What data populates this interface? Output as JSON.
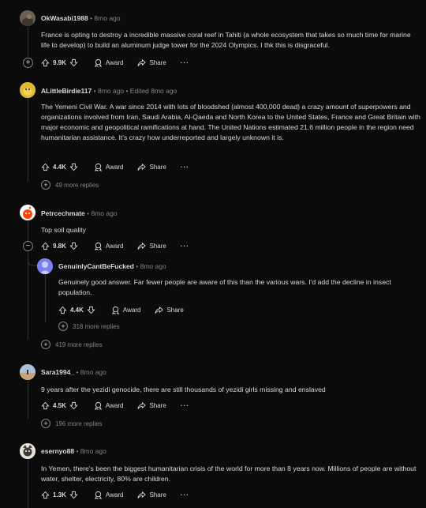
{
  "comments": [
    {
      "author": "OkWasabi1988",
      "time": "8mo ago",
      "body": "France is opting to destroy a incredible massive coral reef in Tahiti (a whole ecosystem that takes so much time for marine life to develop) to build an aluminum judge tower for the 2024 Olympics. I thk this is disgraceful.",
      "votes": "9.9K",
      "award": "Award",
      "share": "Share",
      "expand": "+"
    },
    {
      "author": "ALittleBirdie117",
      "time": "8mo ago",
      "edited": "Edited 8mo ago",
      "body": "The Yemeni Civil War. A war since 2014 with lots of bloodshed (almost 400,000 dead) a crazy amount of superpowers and organizations involved from Iran, Saudi Arabia, Al-Qaeda and North Korea to the United States, France and Great Britain with major economic and geopolitical ramifications at hand. The United Nations estimated 21.6 million people in the region need humanitarian assistance. It's crazy how underreported and largely unknown it is.",
      "votes": "4.4K",
      "award": "Award",
      "share": "Share",
      "more_replies": "49 more replies"
    },
    {
      "author": "Petrcechmate",
      "time": "8mo ago",
      "body": "Top soil quality",
      "votes": "9.8K",
      "award": "Award",
      "share": "Share",
      "collapse": "−",
      "more_replies": "419 more replies",
      "reply": {
        "author": "GenuinlyCantBeFucked",
        "time": "8mo ago",
        "body": "Genuinely good answer. Far fewer people are aware of this than the various wars. I'd add the decline in insect population.",
        "votes": "4.4K",
        "award": "Award",
        "share": "Share",
        "more_replies": "318 more replies"
      }
    },
    {
      "author": "Sara1994_",
      "time": "8mo ago",
      "body": "9 years after the yezidi genocide, there are still thousands of yezidi girls missing and enslaved",
      "votes": "4.5K",
      "award": "Award",
      "share": "Share",
      "more_replies": "196 more replies"
    },
    {
      "author": "esernyo88",
      "time": "8mo ago",
      "body": "In Yemen, there's been the biggest humanitarian crisis of the world for more than 8 years now. Millions of people are without water, shelter, electricity, 80% are children.",
      "votes": "1.3K",
      "award": "Award",
      "share": "Share"
    }
  ],
  "icons": {
    "upvote": "upvote-icon",
    "downvote": "downvote-icon",
    "award": "award-icon",
    "share": "share-icon",
    "overflow": "overflow-menu-icon",
    "expand": "plus-icon"
  },
  "colors": {
    "background": "#0b0b0b",
    "text": "#d7dadc",
    "muted": "#818384",
    "thread_line": "#343536"
  }
}
